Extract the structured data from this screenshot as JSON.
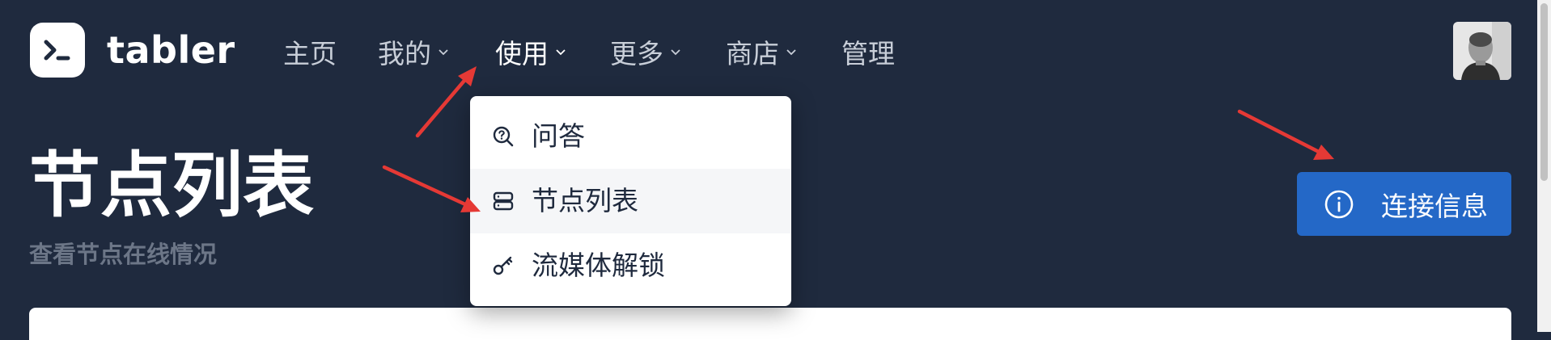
{
  "brand": {
    "name": "tabler",
    "logo_icon": "terminal-icon"
  },
  "nav": {
    "items": [
      {
        "label": "主页",
        "has_dropdown": false
      },
      {
        "label": "我的",
        "has_dropdown": true
      },
      {
        "label": "使用",
        "has_dropdown": true,
        "active": true
      },
      {
        "label": "更多",
        "has_dropdown": true
      },
      {
        "label": "商店",
        "has_dropdown": true
      },
      {
        "label": "管理",
        "has_dropdown": false
      }
    ]
  },
  "dropdown": {
    "items": [
      {
        "label": "问答",
        "icon": "search-question-icon"
      },
      {
        "label": "节点列表",
        "icon": "server-icon",
        "highlighted": true
      },
      {
        "label": "流媒体解锁",
        "icon": "key-icon"
      }
    ]
  },
  "page": {
    "title": "节点列表",
    "subtitle": "查看节点在线情况"
  },
  "actions": {
    "connect_label": "连接信息",
    "connect_icon": "info-circle-icon"
  },
  "annotations": {
    "arrow_color": "#e53935",
    "count": 3
  },
  "colors": {
    "background": "#1f2a3e",
    "primary": "#2468c7",
    "text_muted": "#6c7687"
  }
}
